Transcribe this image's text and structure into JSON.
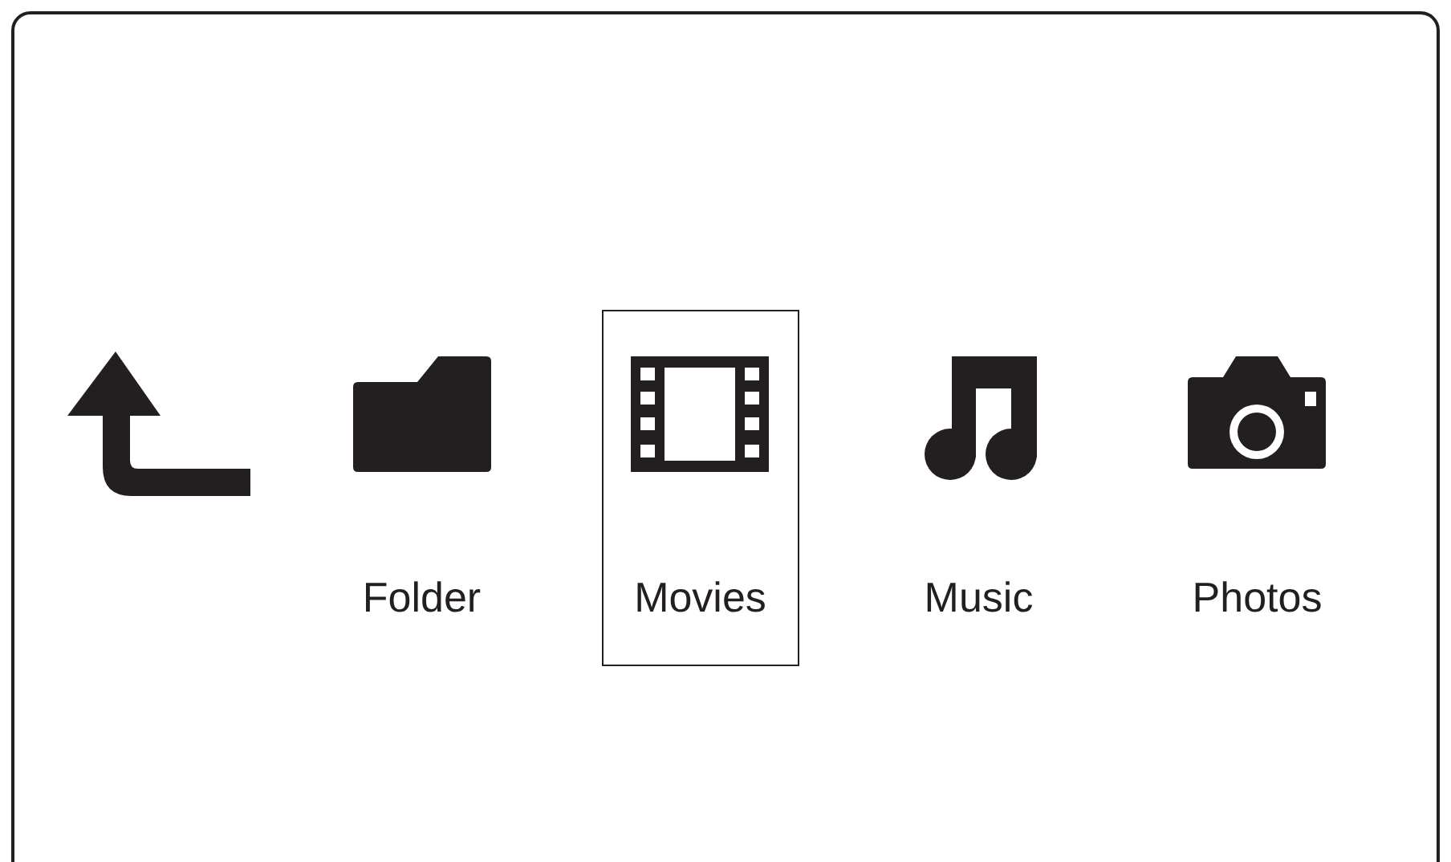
{
  "items": [
    {
      "kind": "back",
      "selected": false
    },
    {
      "kind": "folder",
      "label": "Folder",
      "selected": false
    },
    {
      "kind": "movies",
      "label": "Movies",
      "selected": true
    },
    {
      "kind": "music",
      "label": "Music",
      "selected": false
    },
    {
      "kind": "photos",
      "label": "Photos",
      "selected": false
    }
  ]
}
